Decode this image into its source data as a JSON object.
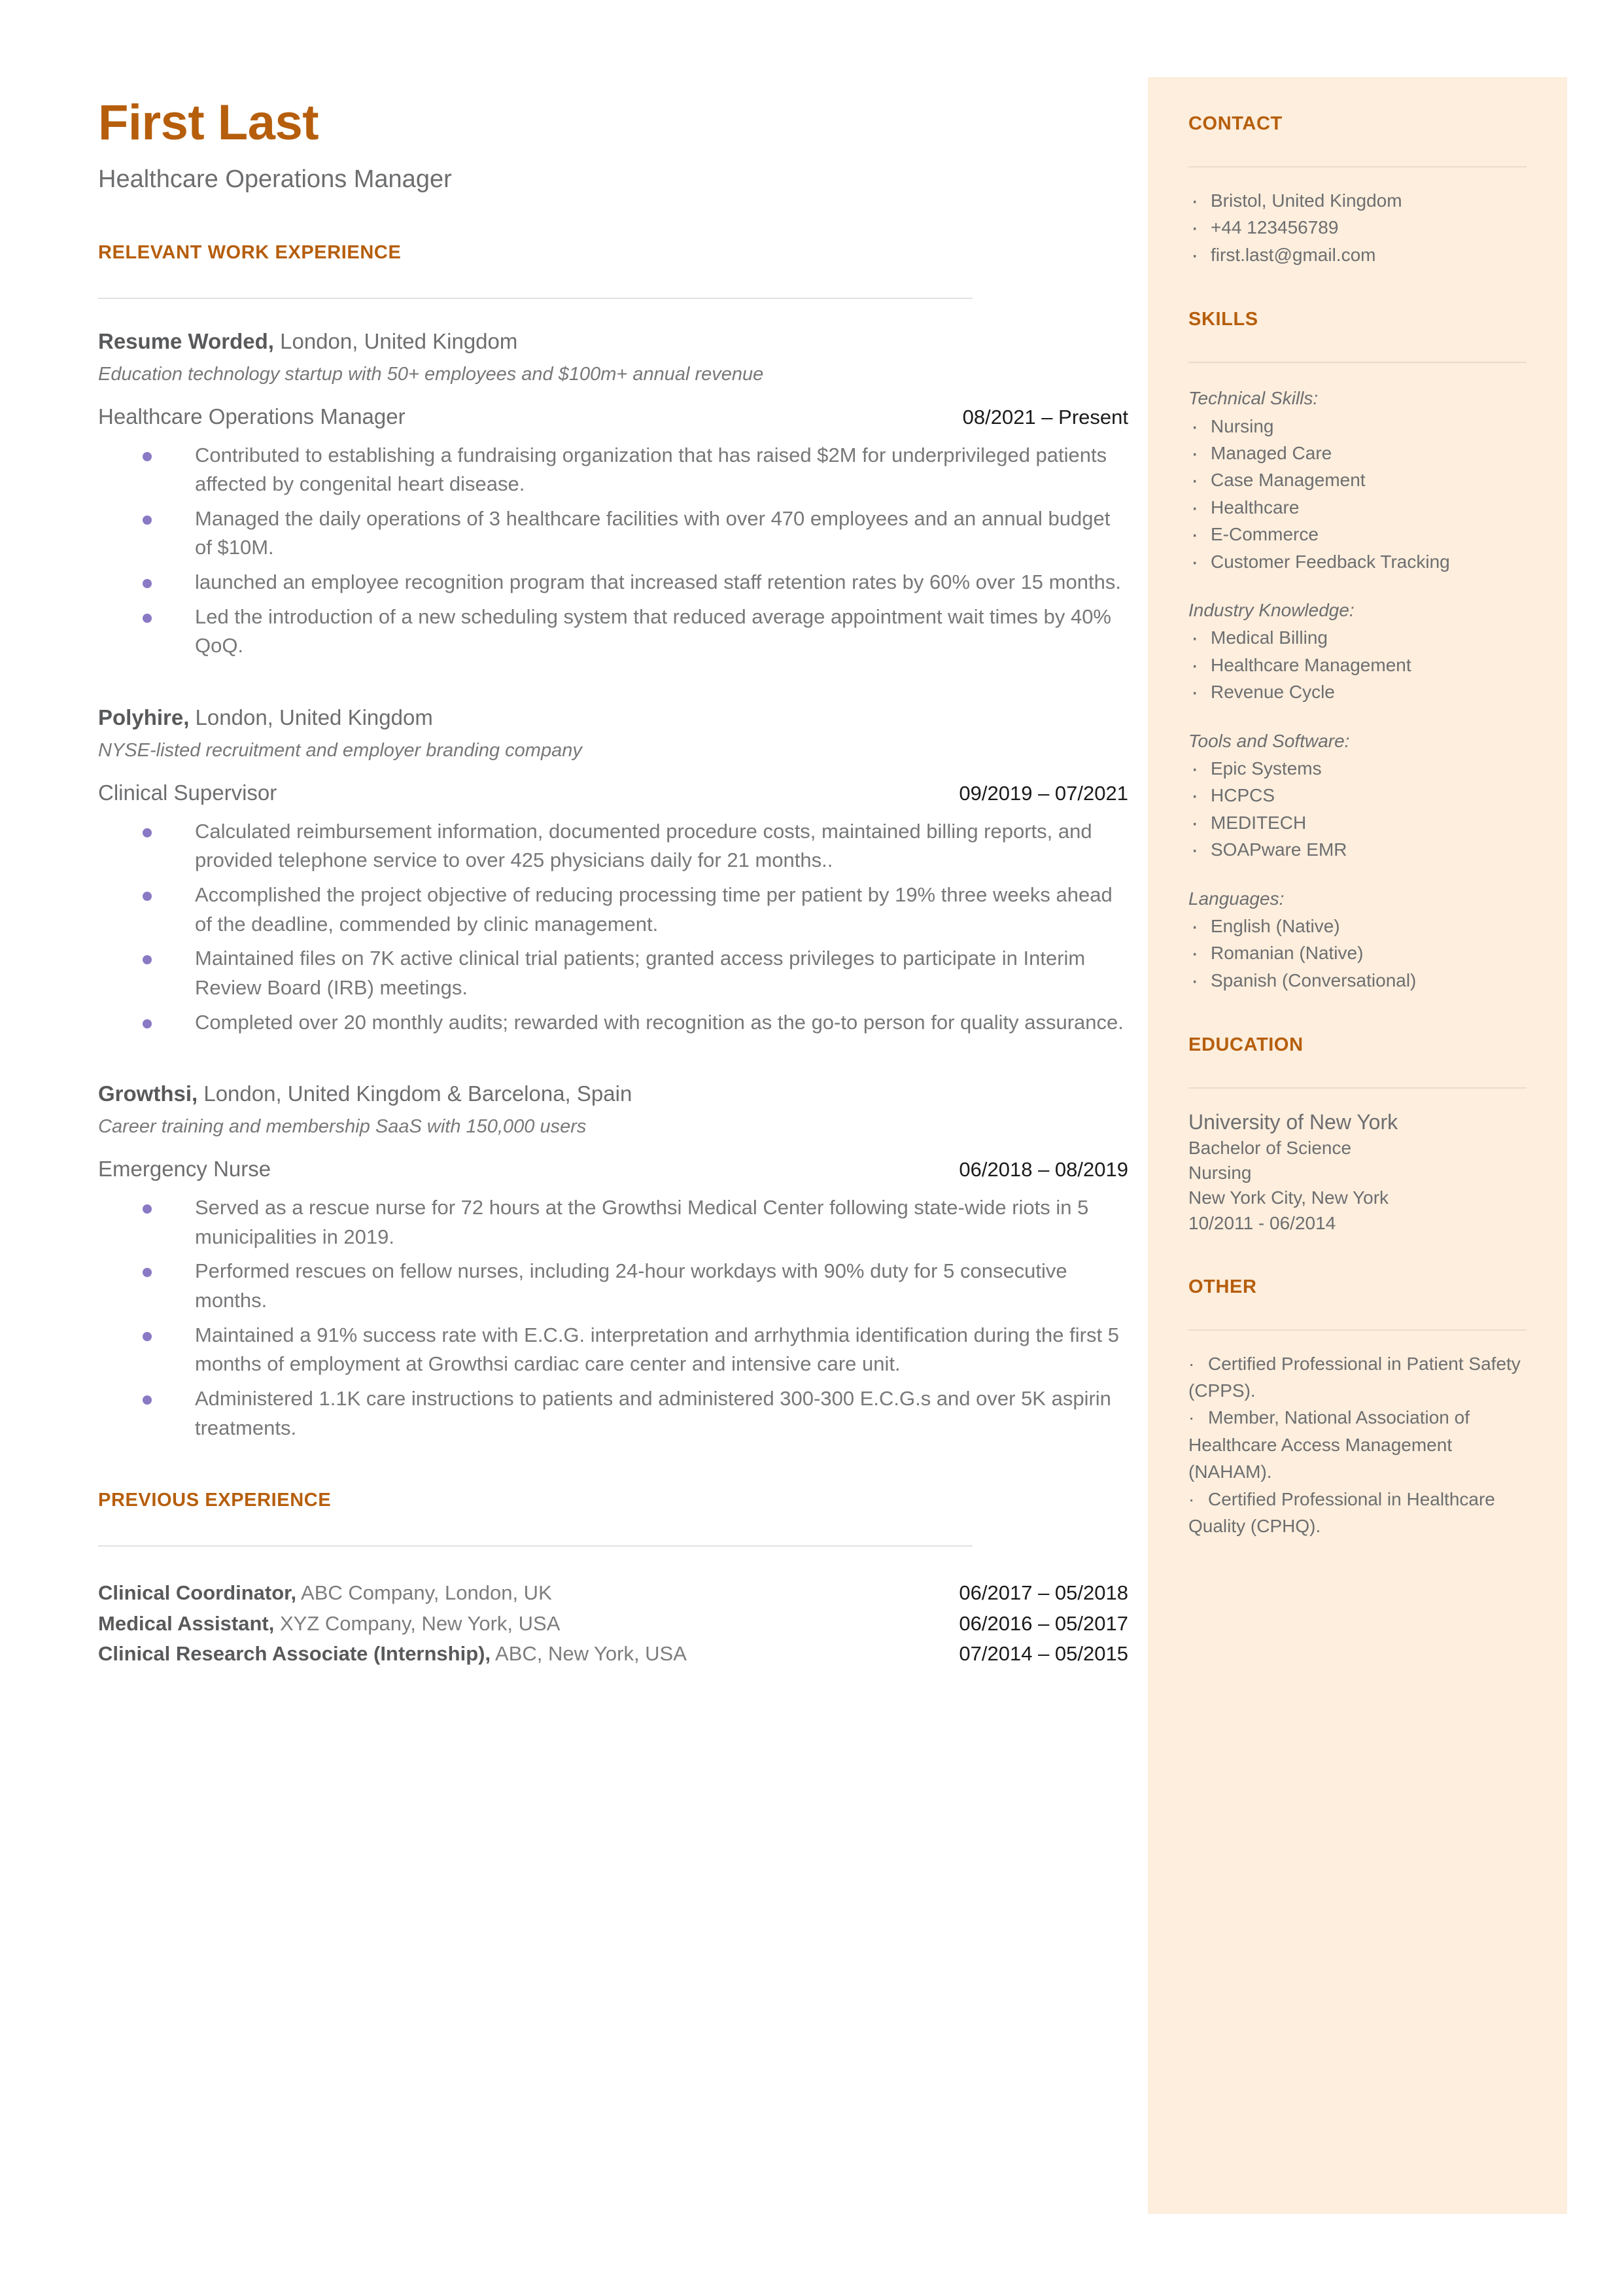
{
  "theme": {
    "accent": "#b65e0c",
    "sidebar_bg": "#fdeedd",
    "body_text": "#6d6e70",
    "bullet_dot": "#8a79c4",
    "date_text": "#1a1a1a",
    "rule": "#e2e2e2"
  },
  "header": {
    "name": "First Last",
    "headline": "Healthcare Operations Manager"
  },
  "work": {
    "section_title": "RELEVANT WORK EXPERIENCE",
    "jobs": [
      {
        "company": "Resume Worded,",
        "location": " London, United Kingdom",
        "description": "Education technology startup with 50+ employees and $100m+ annual revenue",
        "role": "Healthcare Operations Manager",
        "dates": "08/2021 – Present",
        "bullets": [
          "Contributed to establishing a fundraising organization that has raised $2M for underprivileged patients affected by congenital heart disease.",
          "Managed the daily operations of 3 healthcare facilities with over 470 employees and an annual budget of $10M.",
          "launched an employee recognition program that increased staff retention rates by 60% over 15 months.",
          "Led the introduction of a new scheduling system that reduced average appointment wait times by 40% QoQ."
        ]
      },
      {
        "company": "Polyhire,",
        "location": " London, United Kingdom",
        "description": "NYSE-listed recruitment and employer branding company",
        "role": "Clinical Supervisor",
        "dates": "09/2019 – 07/2021",
        "bullets": [
          "Calculated reimbursement information, documented procedure costs, maintained billing reports, and provided telephone service to over 425 physicians daily for 21 months..",
          "Accomplished the project objective of reducing processing time per patient by 19% three weeks ahead of the deadline, commended by clinic management.",
          "Maintained files on 7K active clinical trial patients; granted access privileges to participate in Interim Review Board (IRB) meetings.",
          "Completed over 20 monthly audits; rewarded with recognition as the go-to person for quality assurance."
        ]
      },
      {
        "company": "Growthsi,",
        "location": " London, United Kingdom & Barcelona, Spain",
        "description": "Career training and membership SaaS with 150,000 users",
        "role": "Emergency Nurse",
        "dates": "06/2018 – 08/2019",
        "bullets": [
          "Served as a rescue nurse for 72 hours at the Growthsi Medical Center following state-wide riots in 5 municipalities in 2019.",
          "Performed rescues on fellow nurses, including 24-hour workdays with 90% duty for 5 consecutive months.",
          "Maintained a 91% success rate with E.C.G. interpretation and arrhythmia identification during the first 5 months of employment at Growthsi cardiac care center and intensive care unit.",
          "Administered 1.1K care instructions to patients and administered 300-300 E.C.G.s and over 5K aspirin treatments."
        ]
      }
    ]
  },
  "previous": {
    "section_title": "PREVIOUS EXPERIENCE",
    "rows": [
      {
        "title": "Clinical Coordinator,",
        "detail": " ABC Company, London, UK",
        "dates": "06/2017 – 05/2018"
      },
      {
        "title": "Medical Assistant,",
        "detail": " XYZ Company, New York, USA",
        "dates": "06/2016 – 05/2017"
      },
      {
        "title": "Clinical Research Associate (Internship),",
        "detail": " ABC, New York, USA",
        "dates": "07/2014 – 05/2015"
      }
    ]
  },
  "contact": {
    "section_title": "CONTACT",
    "items": [
      "Bristol, United Kingdom",
      "+44 123456789",
      "first.last@gmail.com"
    ]
  },
  "skills": {
    "section_title": "SKILLS",
    "groups": [
      {
        "label": "Technical Skills:",
        "items": [
          "Nursing",
          "Managed Care",
          "Case Management",
          "Healthcare",
          "E-Commerce",
          "Customer Feedback Tracking"
        ]
      },
      {
        "label": "Industry Knowledge:",
        "items": [
          "Medical Billing",
          "Healthcare Management",
          "Revenue Cycle"
        ]
      },
      {
        "label": "Tools and Software:",
        "items": [
          "Epic Systems",
          "HCPCS",
          "MEDITECH",
          "SOAPware EMR"
        ]
      },
      {
        "label": "Languages:",
        "items": [
          "English (Native)",
          "Romanian (Native)",
          "Spanish (Conversational)"
        ]
      }
    ]
  },
  "education": {
    "section_title": "EDUCATION",
    "school": "University of New York",
    "degree": "Bachelor of Science",
    "field": "Nursing",
    "location": "New York City, New York",
    "dates": "10/2011 - 06/2014"
  },
  "other": {
    "section_title": "OTHER",
    "items": [
      "Certified Professional in Patient Safety (CPPS).",
      "Member, National Association of Healthcare Access Management (NAHAM).",
      "Certified Professional in Healthcare Quality (CPHQ)."
    ]
  }
}
